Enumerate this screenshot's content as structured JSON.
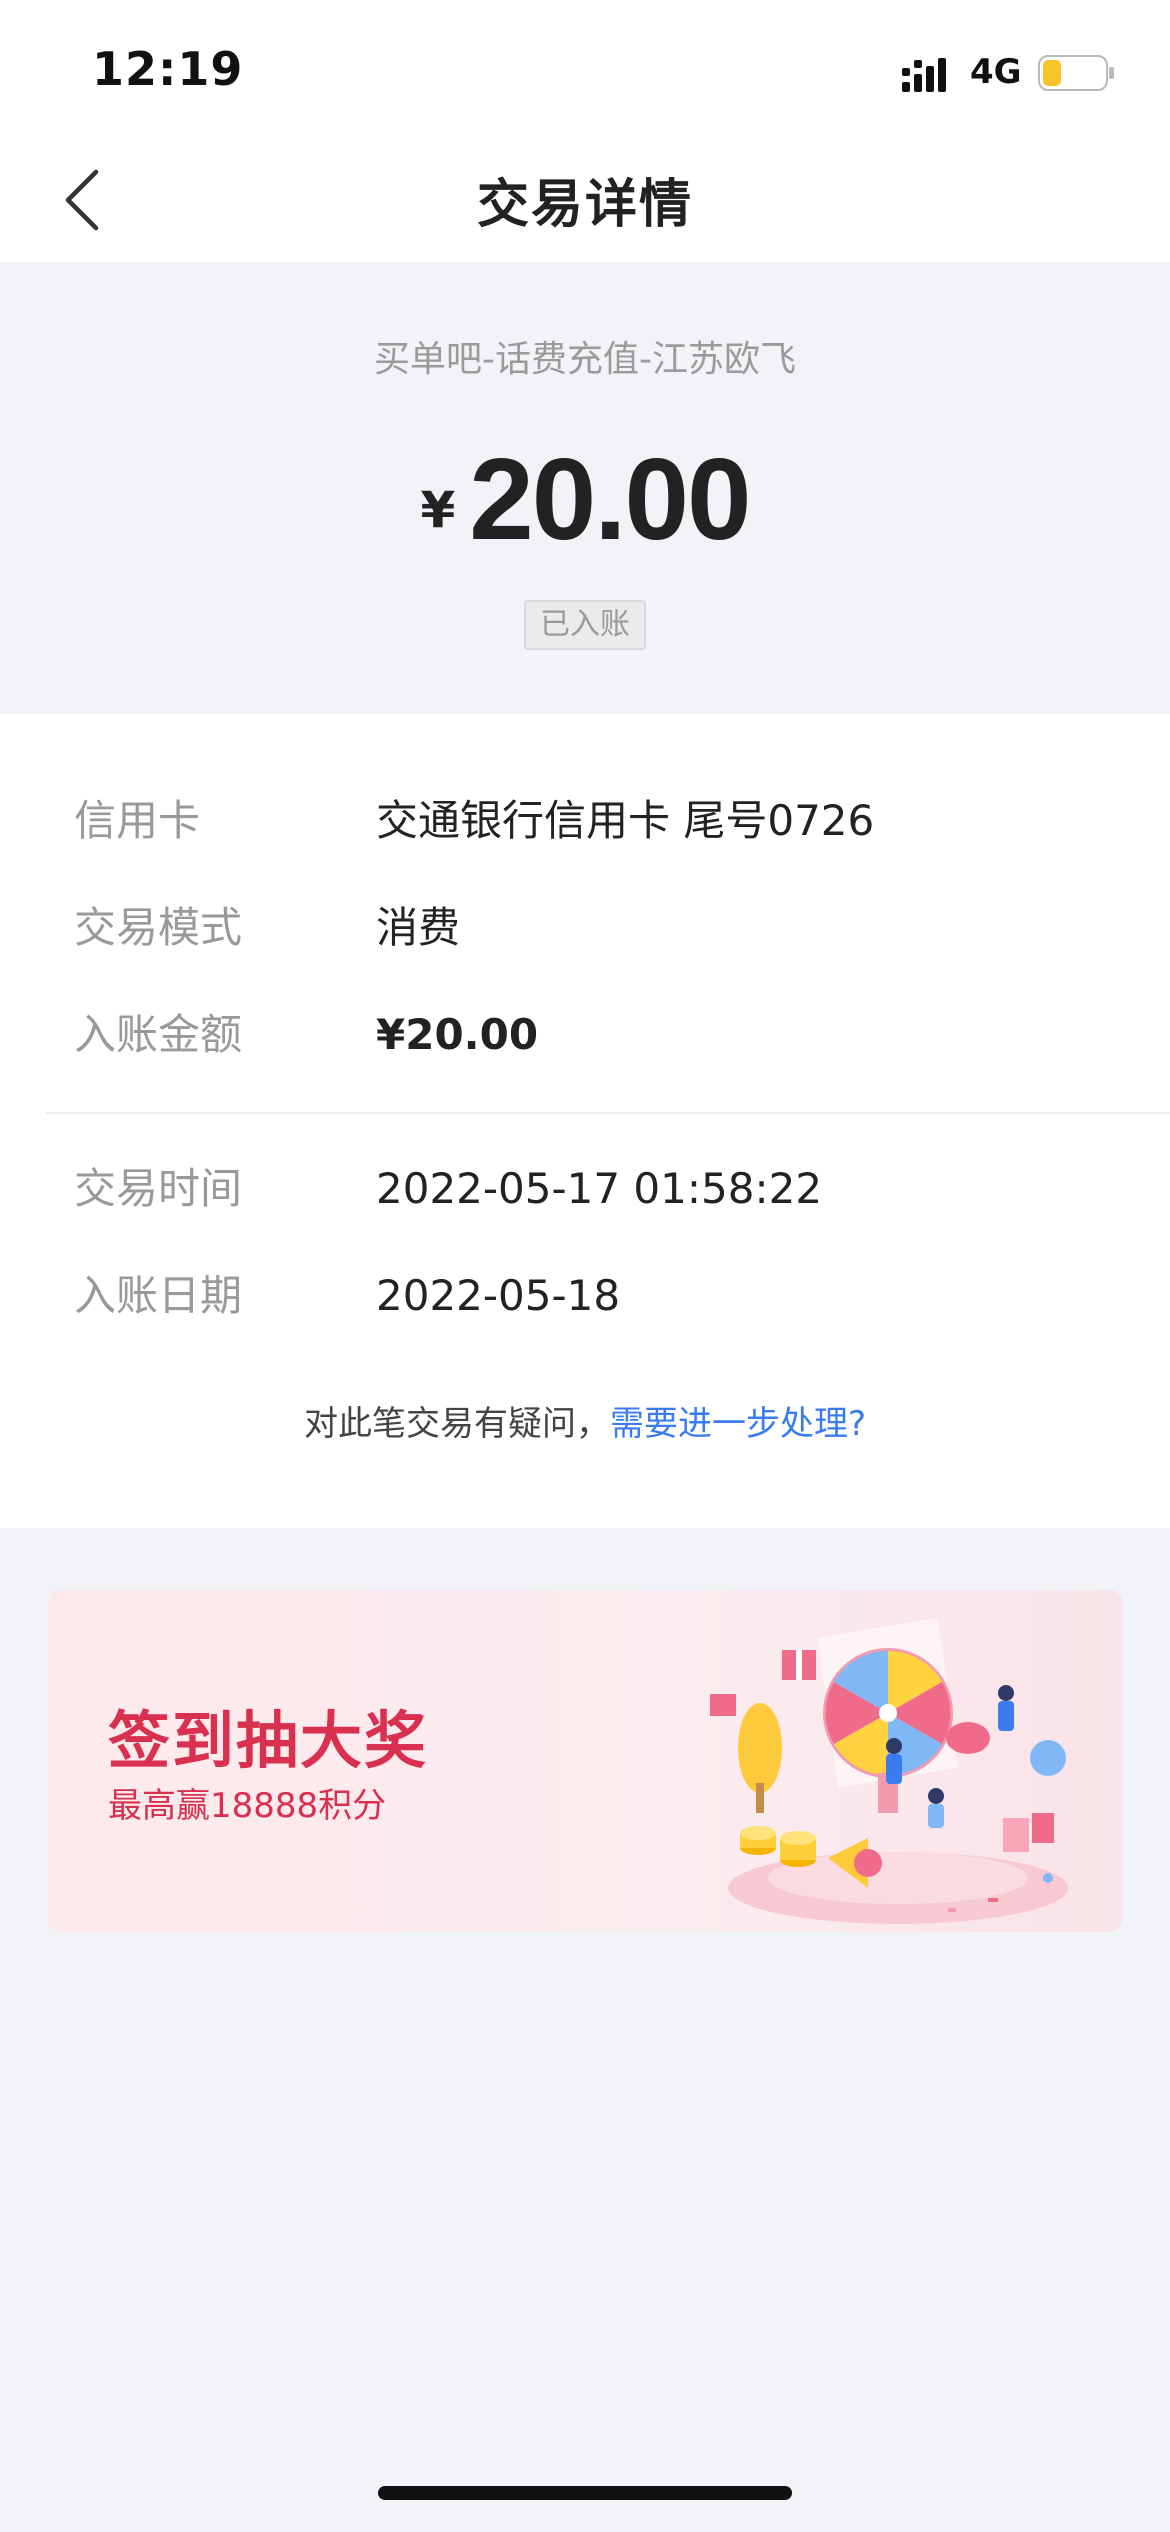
{
  "status_bar": {
    "time": "12:19",
    "network": "4G",
    "signal_icon": "signal-bars-icon",
    "battery_icon": "battery-low-icon",
    "battery_color": "#f7c52b"
  },
  "nav": {
    "title": "交易详情",
    "back_icon": "chevron-left-icon"
  },
  "summary": {
    "merchant": "买单吧-话费充值-江苏欧飞",
    "currency_symbol": "¥",
    "amount": "20.00",
    "status": "已入账"
  },
  "details": {
    "rows": [
      {
        "label": "信用卡",
        "value": "交通银行信用卡 尾号0726"
      },
      {
        "label": "交易模式",
        "value": "消费"
      },
      {
        "label": "入账金额",
        "value": "¥20.00"
      },
      {
        "label": "交易时间",
        "value": "2022-05-17 01:58:22"
      },
      {
        "label": "入账日期",
        "value": "2022-05-18"
      }
    ],
    "inquiry_text": "对此笔交易有疑问，",
    "inquiry_link": "需要进一步处理?",
    "link_color": "#3a7cf0"
  },
  "promo": {
    "title": "签到抽大奖",
    "subtitle": "最高赢18888积分",
    "accent_color": "#d8304e",
    "illustration_icon": "prize-wheel-illustration-icon"
  }
}
